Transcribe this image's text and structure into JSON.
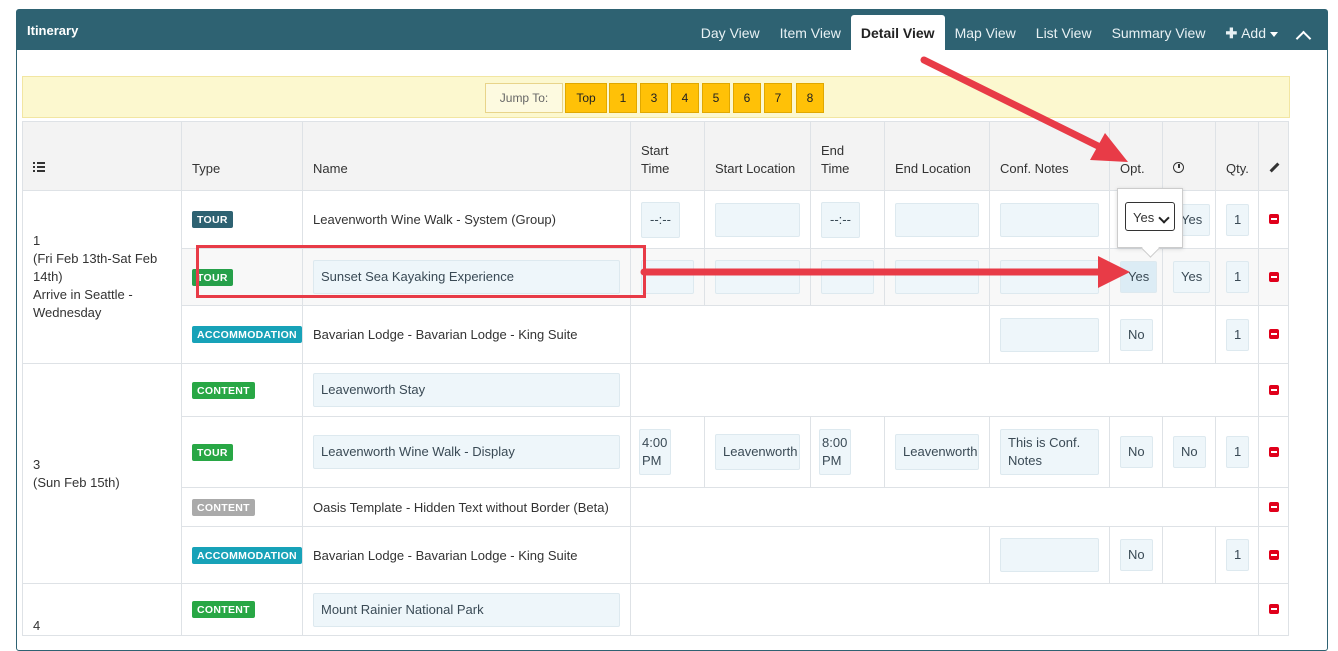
{
  "header": {
    "title": "Itinerary",
    "tabs": [
      "Day View",
      "Item View",
      "Detail View",
      "Map View",
      "List View",
      "Summary View"
    ],
    "add_label": "Add",
    "active_tab": "Detail View"
  },
  "jump": {
    "label": "Jump To:",
    "buttons": [
      "Top",
      "1",
      "3",
      "4",
      "5",
      "6",
      "7",
      "8"
    ]
  },
  "columns": {
    "type": "Type",
    "name": "Name",
    "start_time": "Start Time",
    "start_location": "Start Location",
    "end_time": "End Time",
    "end_location": "End Location",
    "conf_notes": "Conf. Notes",
    "opt": "Opt.",
    "qty": "Qty."
  },
  "days": [
    {
      "num": "1",
      "date": "(Fri Feb 13th-Sat Feb 14th)",
      "title": "Arrive in Seattle - Wednesday"
    },
    {
      "num": "3",
      "date": "(Sun Feb 15th)",
      "title": ""
    },
    {
      "num": "4",
      "date": "",
      "title": ""
    }
  ],
  "rows": [
    {
      "type": "TOUR",
      "name": "Leavenworth Wine Walk - System (Group)",
      "start_time": "--:--",
      "end_time": "--:--",
      "opt": "Yes",
      "clock": "Yes",
      "qty": "1"
    },
    {
      "type": "TOUR",
      "name": "Sunset Sea Kayaking Experience",
      "opt": "Yes",
      "clock": "Yes",
      "qty": "1"
    },
    {
      "type": "ACCOMMODATION",
      "name": "Bavarian Lodge - Bavarian Lodge - King Suite",
      "opt": "No",
      "qty": "1"
    },
    {
      "type": "CONTENT",
      "name": "Leavenworth Stay"
    },
    {
      "type": "TOUR",
      "name": "Leavenworth Wine Walk - Display",
      "start_time": "4:00 PM",
      "start_location": "Leavenworth",
      "end_time": "8:00 PM",
      "end_location": "Leavenworth",
      "conf_notes": "This is Conf. Notes",
      "opt": "No",
      "clock": "No",
      "qty": "1"
    },
    {
      "type": "CONTENT",
      "name": "Oasis Template - Hidden Text without Border (Beta)"
    },
    {
      "type": "ACCOMMODATION",
      "name": "Bavarian Lodge - Bavarian Lodge - King Suite",
      "opt": "No",
      "qty": "1"
    },
    {
      "type": "CONTENT",
      "name": "Mount Rainier National Park"
    }
  ],
  "select_value": "Yes",
  "colors": {
    "header": "#2e6272",
    "jump": "#ffc107",
    "annotation": "#e83b47"
  }
}
